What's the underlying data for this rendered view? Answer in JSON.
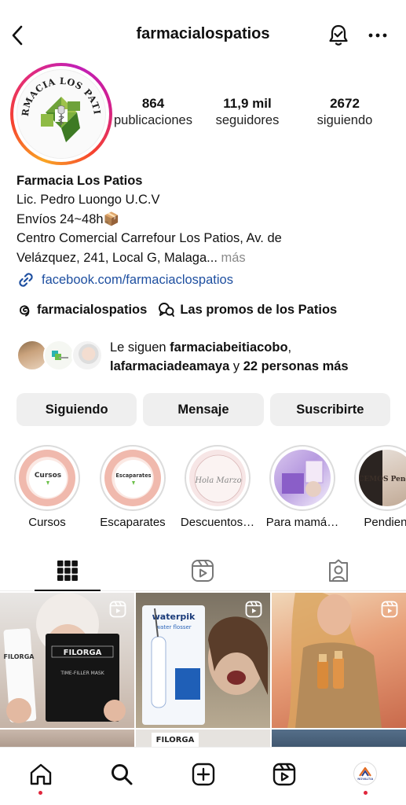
{
  "header": {
    "username": "farmacialospatios"
  },
  "profile": {
    "avatar_text": "FARMACIA LOS PATIOS",
    "stats": [
      {
        "value": "864",
        "label": "publicaciones"
      },
      {
        "value": "11,9 mil",
        "label": "seguidores"
      },
      {
        "value": "2672",
        "label": "siguiendo"
      }
    ],
    "name": "Farmacia Los Patios",
    "bio_lines": [
      "Lic. Pedro Luongo U.C.V",
      "Envíos 24~48h📦",
      "Centro Comercial Carrefour Los Patios, Av. de",
      "Velázquez, 241, Local G, Malaga..."
    ],
    "more_label": "más",
    "link": "facebook.com/farmaciaclospatios",
    "threads_handle": "farmacialospatios",
    "channel": "Las promos de los Patios"
  },
  "followers": {
    "prefix": "Le siguen ",
    "first": "farmaciabeitiacobo",
    "second": "lafarmaciadeamaya",
    "joiner": " y ",
    "rest": "22 personas más"
  },
  "buttons": {
    "following": "Siguiendo",
    "message": "Mensaje",
    "subscribe": "Suscribirte"
  },
  "highlights": [
    {
      "label": "Cursos",
      "text": "Cursos"
    },
    {
      "label": "Escaparates",
      "text": "Escaparates"
    },
    {
      "label": "Descuentos…",
      "text": "Hola Marzo"
    },
    {
      "label": "Para mamá…",
      "text": ""
    },
    {
      "label": "Pendient",
      "text": "HACEMOS Pendientes"
    }
  ],
  "posts": [
    {
      "brand": "FILORGA",
      "caption": "TIME-FILLER MASK"
    },
    {
      "brand": "waterpik",
      "caption": "water flosser"
    },
    {
      "brand": "",
      "caption": ""
    }
  ],
  "second_row_brand": "FILORGA",
  "nav_avatar_text": "NOVALTIA",
  "colors": {
    "link": "#1e4fa0",
    "accent_red": "#e0263c",
    "button_bg": "#efefef"
  }
}
